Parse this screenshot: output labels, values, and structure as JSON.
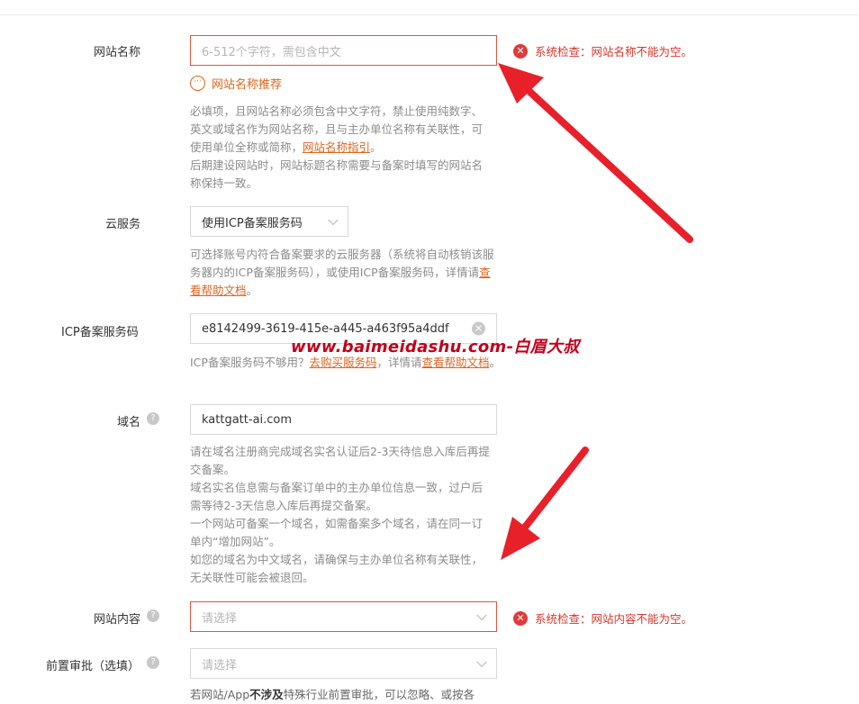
{
  "form": {
    "site_name": {
      "label": "网站名称",
      "placeholder": "6-512个字符，需包含中文",
      "error": "系统检查：网站名称不能为空。",
      "suggest_link": "网站名称推荐",
      "help_text": "必填项，且网站名称必须包含中文字符，禁止使用纯数字、英文或域名作为网站名称，且与主办单位名称有关联性，可使用单位全称或简称，",
      "help_link": "网站名称指引",
      "help_end": "。",
      "help_text2": "后期建设网站时，网站标题名称需要与备案时填写的网站名称保持一致。"
    },
    "cloud_service": {
      "label": "云服务",
      "value": "使用ICP备案服务码",
      "help_text": "可选择账号内符合备案要求的云服务器（系统将自动核销该服务器内的ICP备案服务码），或使用ICP备案服务码，详情请",
      "help_link": "查看帮助文档",
      "help_end": "。"
    },
    "icp_code": {
      "label": "ICP备案服务码",
      "value": "e8142499-3619-415e-a445-a463f95a4ddf",
      "help_text": "ICP备案服务码不够用？",
      "help_link1": "去购买服务码",
      "help_mid": "，详情请",
      "help_link2": "查看帮助文档",
      "help_end": "。"
    },
    "domain": {
      "label": "域名",
      "value": "kattgatt-ai.com",
      "help_lines": [
        "请在域名注册商完成域名实名认证后2-3天待信息入库后再提交备案。",
        "域名实名信息需与备案订单中的主办单位信息一致，过户后需等待2-3天信息入库后再提交备案。",
        "一个网站可备案一个域名，如需备案多个域名，请在同一订单内“增加网站”。",
        "如您的域名为中文域名，请确保与主办单位名称有关联性，无关联性可能会被退回。"
      ]
    },
    "site_content": {
      "label": "网站内容",
      "placeholder": "请选择",
      "error": "系统检查：网站内容不能为空。"
    },
    "pre_approval": {
      "label": "前置审批（选填）",
      "placeholder": "请选择",
      "help_pre": "若网站/App",
      "help_bold": "不涉及",
      "help_post": "特殊行业前置审批，可以忽略、或按各"
    }
  },
  "watermark": "www.baimeidashu.com-白眉大叔",
  "colors": {
    "error": "#d9342b",
    "link": "#e0641e",
    "arrow": "#e8202a"
  }
}
